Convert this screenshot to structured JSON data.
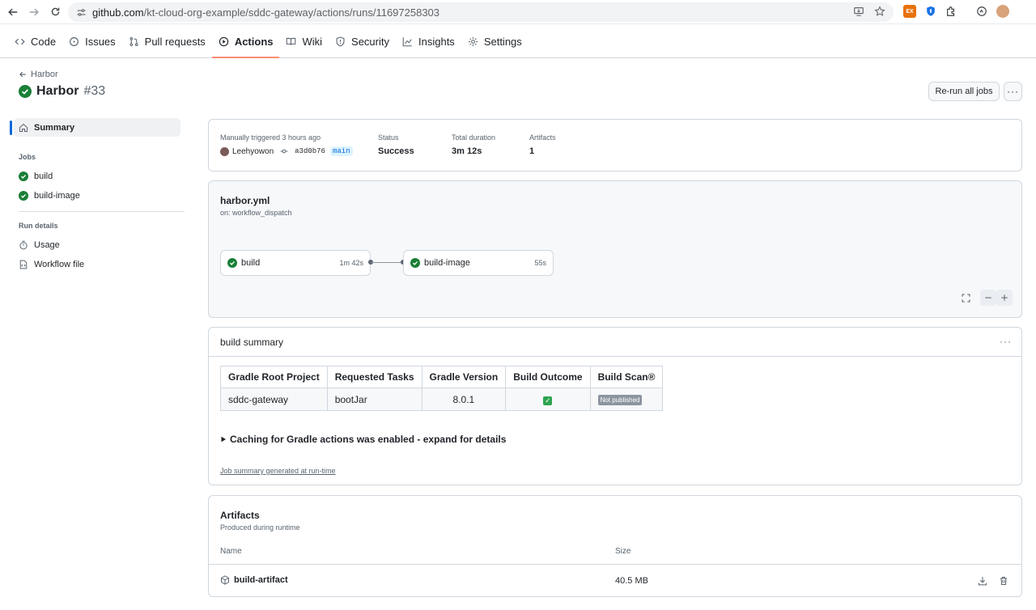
{
  "browser": {
    "url_host": "github.com",
    "url_path": "/kt-cloud-org-example/sddc-gateway/actions/runs/11697258303",
    "ext_badge": "EX"
  },
  "repo_nav": {
    "tabs": [
      {
        "label": "Code",
        "icon": "code-icon"
      },
      {
        "label": "Issues",
        "icon": "issue-icon"
      },
      {
        "label": "Pull requests",
        "icon": "pull-request-icon"
      },
      {
        "label": "Actions",
        "icon": "play-icon",
        "active": true
      },
      {
        "label": "Wiki",
        "icon": "book-icon"
      },
      {
        "label": "Security",
        "icon": "shield-icon"
      },
      {
        "label": "Insights",
        "icon": "graph-icon"
      },
      {
        "label": "Settings",
        "icon": "gear-icon"
      }
    ]
  },
  "run": {
    "back_label": "Harbor",
    "name": "Harbor",
    "number": "#33",
    "rerun_label": "Re-run all jobs",
    "more_label": "···"
  },
  "sidebar": {
    "summary_label": "Summary",
    "jobs_heading": "Jobs",
    "jobs": [
      "build",
      "build-image"
    ],
    "run_details_heading": "Run details",
    "usage_label": "Usage",
    "workflow_file_label": "Workflow file"
  },
  "summary": {
    "trigger_text": "Manually triggered 3 hours ago",
    "actor": "Leehyowon",
    "commit": "a3d0b76",
    "branch": "main",
    "status_label": "Status",
    "status_value": "Success",
    "duration_label": "Total duration",
    "duration_value": "3m 12s",
    "artifacts_label": "Artifacts",
    "artifacts_value": "1"
  },
  "graph": {
    "workflow_file": "harbor.yml",
    "on_event": "on: workflow_dispatch",
    "jobs": [
      {
        "name": "build",
        "duration": "1m 42s"
      },
      {
        "name": "build-image",
        "duration": "55s"
      }
    ]
  },
  "build_summary": {
    "title": "build summary",
    "more_label": "···",
    "headers": [
      "Gradle Root Project",
      "Requested Tasks",
      "Gradle Version",
      "Build Outcome",
      "Build Scan®"
    ],
    "row": {
      "project": "sddc-gateway",
      "tasks": "bootJar",
      "version": "8.0.1",
      "outcome": "✓",
      "scan": "Not published"
    },
    "details_text": "Caching for Gradle actions was enabled - expand for details",
    "generated_text": "Job summary generated at run-time"
  },
  "artifacts": {
    "title": "Artifacts",
    "subtitle": "Produced during runtime",
    "col_name": "Name",
    "col_size": "Size",
    "items": [
      {
        "name": "build-artifact",
        "size": "40.5 MB"
      }
    ]
  },
  "colors": {
    "success": "#1a7f37",
    "accent": "#0969da",
    "tab_underline": "#fd8c73"
  }
}
